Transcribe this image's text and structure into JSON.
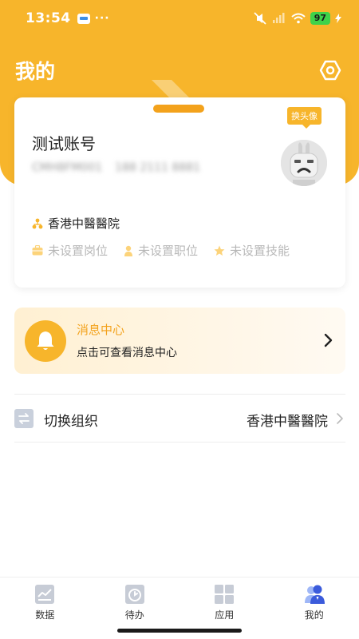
{
  "status_bar": {
    "time": "13:54",
    "dots": "···",
    "battery": "97"
  },
  "header": {
    "title": "我的",
    "settings_icon": "hexagon-settings-icon"
  },
  "profile": {
    "account_name": "测试账号",
    "user_id": "CMH8FM001",
    "phone": "188 2111 8881",
    "avatar_label": "换头像",
    "organization": "香港中醫醫院",
    "tags": [
      {
        "icon": "post-icon",
        "label": "未设置岗位"
      },
      {
        "icon": "position-icon",
        "label": "未设置职位"
      },
      {
        "icon": "star-icon",
        "label": "未设置技能"
      }
    ]
  },
  "message_center": {
    "title": "消息中心",
    "subtitle": "点击可查看消息中心"
  },
  "switch_org": {
    "label": "切换组织",
    "value": "香港中醫醫院"
  },
  "tabbar": [
    {
      "label": "数据",
      "icon": "data-icon",
      "active": false
    },
    {
      "label": "待办",
      "icon": "todo-icon",
      "active": false
    },
    {
      "label": "应用",
      "icon": "apps-icon",
      "active": false
    },
    {
      "label": "我的",
      "icon": "mine-icon",
      "active": true
    }
  ],
  "colors": {
    "brand": "#f7b52b",
    "brand_dark": "#f3a21c",
    "active_tab": "#3b5bdb"
  }
}
